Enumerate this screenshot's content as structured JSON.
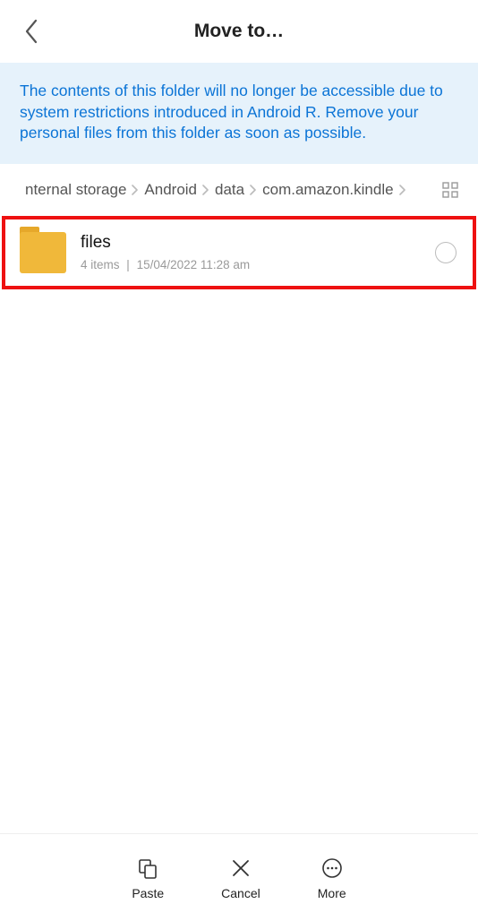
{
  "header": {
    "title": "Move to…"
  },
  "banner": {
    "text": "The contents of this folder will no longer be accessible due to system restrictions introduced in Android R. Remove your personal files from this folder as soon as possible."
  },
  "breadcrumb": {
    "items": [
      "nternal storage",
      "Android",
      "data",
      "com.amazon.kindle"
    ]
  },
  "list": {
    "items": [
      {
        "name": "files",
        "count": "4 items",
        "date": "15/04/2022 11:28 am"
      }
    ]
  },
  "bottom": {
    "paste": "Paste",
    "cancel": "Cancel",
    "more": "More"
  }
}
